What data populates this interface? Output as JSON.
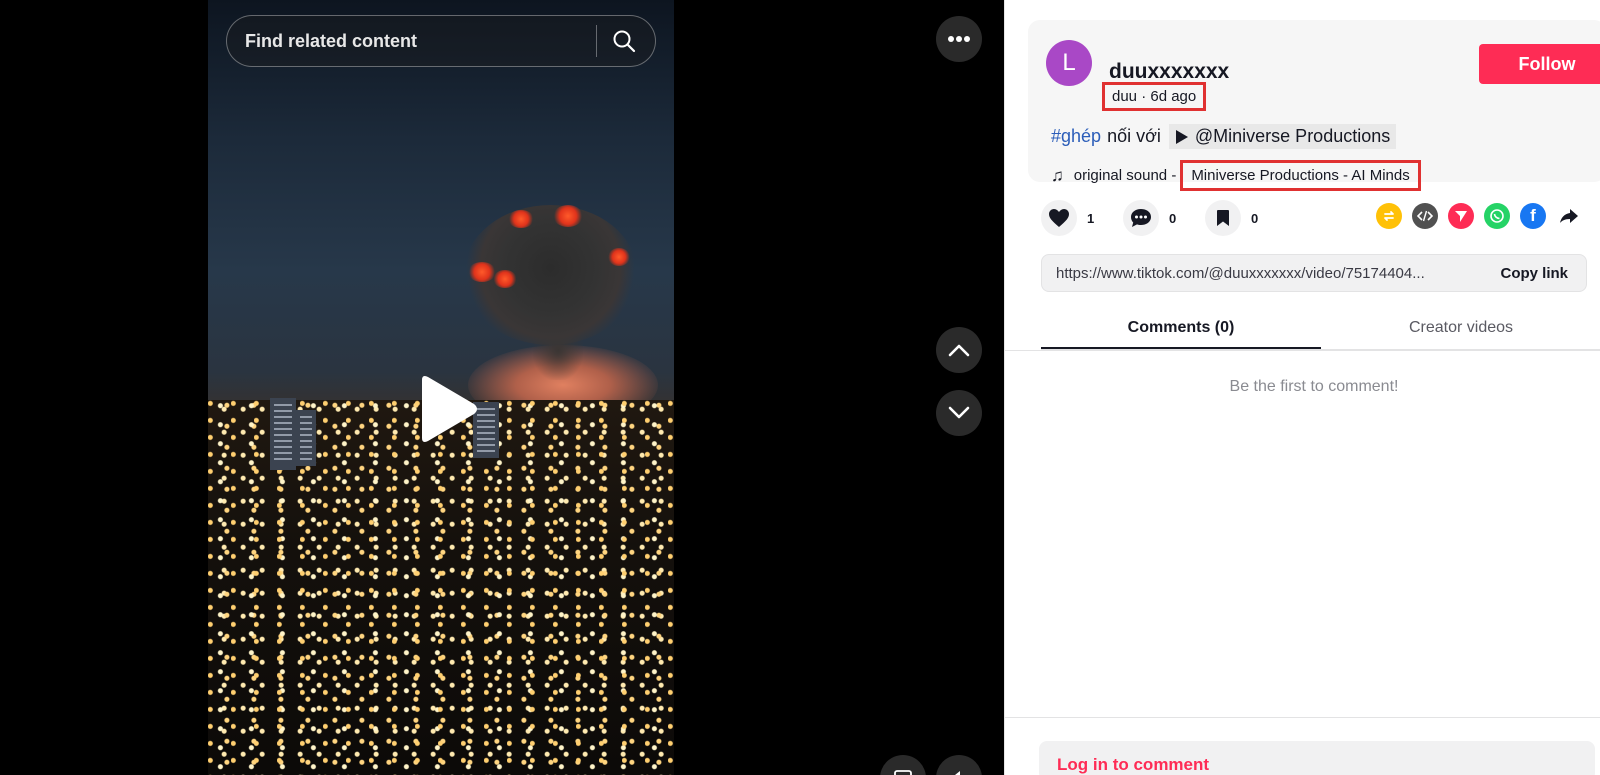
{
  "search": {
    "placeholder": "Find related content"
  },
  "video": {
    "more_icon": "ellipsis-icon",
    "play_icon": "play-icon",
    "nav_up_icon": "chevron-up-icon",
    "nav_down_icon": "chevron-down-icon"
  },
  "post": {
    "avatar_letter": "L",
    "avatar_color": "#a948c6",
    "username": "duuxxxxxxx",
    "meta": "duu · 6d ago",
    "follow_label": "Follow",
    "hashtag": "#ghép",
    "connector": "nối với",
    "mention": "@Miniverse Productions",
    "sound_prefix": "original sound -",
    "sound_name": "Miniverse Productions - AI Minds"
  },
  "actions": {
    "likes": "1",
    "comments": "0",
    "saves": "0"
  },
  "share": {
    "icons": [
      "repost-icon",
      "embed-icon",
      "send-icon",
      "whatsapp-icon",
      "facebook-icon",
      "share-arrow-icon"
    ]
  },
  "link": {
    "url": "https://www.tiktok.com/@duuxxxxxxx/video/75174404...",
    "copy_label": "Copy link"
  },
  "tabs": [
    {
      "label": "Comments (0)",
      "active": true
    },
    {
      "label": "Creator videos",
      "active": false
    }
  ],
  "comments": {
    "empty_text": "Be the first to comment!"
  },
  "footer": {
    "login_label": "Log in to comment"
  },
  "colors": {
    "accent": "#fe2c55",
    "highlight_box": "#e03131",
    "hashtag": "#2b5db9"
  }
}
